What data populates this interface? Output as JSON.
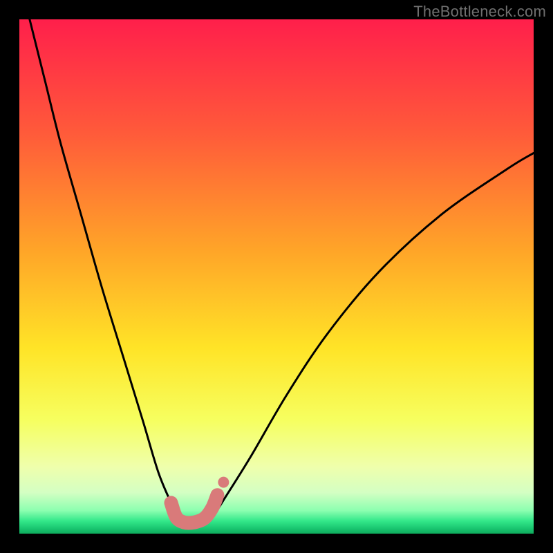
{
  "watermark": "TheBottleneck.com",
  "chart_data": {
    "type": "line",
    "title": "",
    "xlabel": "",
    "ylabel": "",
    "xlim": [
      0,
      100
    ],
    "ylim": [
      0,
      100
    ],
    "series": [
      {
        "name": "bottleneck-curve",
        "x": [
          2,
          5,
          8,
          12,
          16,
          20,
          24,
          27,
          29.5,
          31,
          32.5,
          34,
          36,
          38,
          40,
          45,
          52,
          60,
          70,
          82,
          95,
          100
        ],
        "y": [
          100,
          88,
          76,
          62,
          48,
          35,
          22,
          12,
          6,
          3,
          2,
          2,
          2.5,
          4,
          7,
          15,
          27,
          39,
          51,
          62,
          71,
          74
        ]
      }
    ],
    "highlight_segment": {
      "name": "optimal-range",
      "x": [
        29.5,
        30.5,
        32,
        34,
        36,
        37.5,
        38.5
      ],
      "y": [
        6,
        3.2,
        2.2,
        2.2,
        3,
        5,
        7.5
      ]
    },
    "gradient_stops": [
      {
        "offset": 0.0,
        "color": "#ff1f4b"
      },
      {
        "offset": 0.22,
        "color": "#ff5a3a"
      },
      {
        "offset": 0.45,
        "color": "#ffa528"
      },
      {
        "offset": 0.64,
        "color": "#ffe427"
      },
      {
        "offset": 0.78,
        "color": "#f6ff60"
      },
      {
        "offset": 0.87,
        "color": "#efffac"
      },
      {
        "offset": 0.92,
        "color": "#d4ffc3"
      },
      {
        "offset": 0.955,
        "color": "#8cffb0"
      },
      {
        "offset": 0.975,
        "color": "#34e88a"
      },
      {
        "offset": 0.99,
        "color": "#19c670"
      },
      {
        "offset": 1.0,
        "color": "#0faa5c"
      }
    ],
    "curve_color": "#000000",
    "highlight_color": "#d97a7a",
    "highlight_endcap_radius": 10
  }
}
